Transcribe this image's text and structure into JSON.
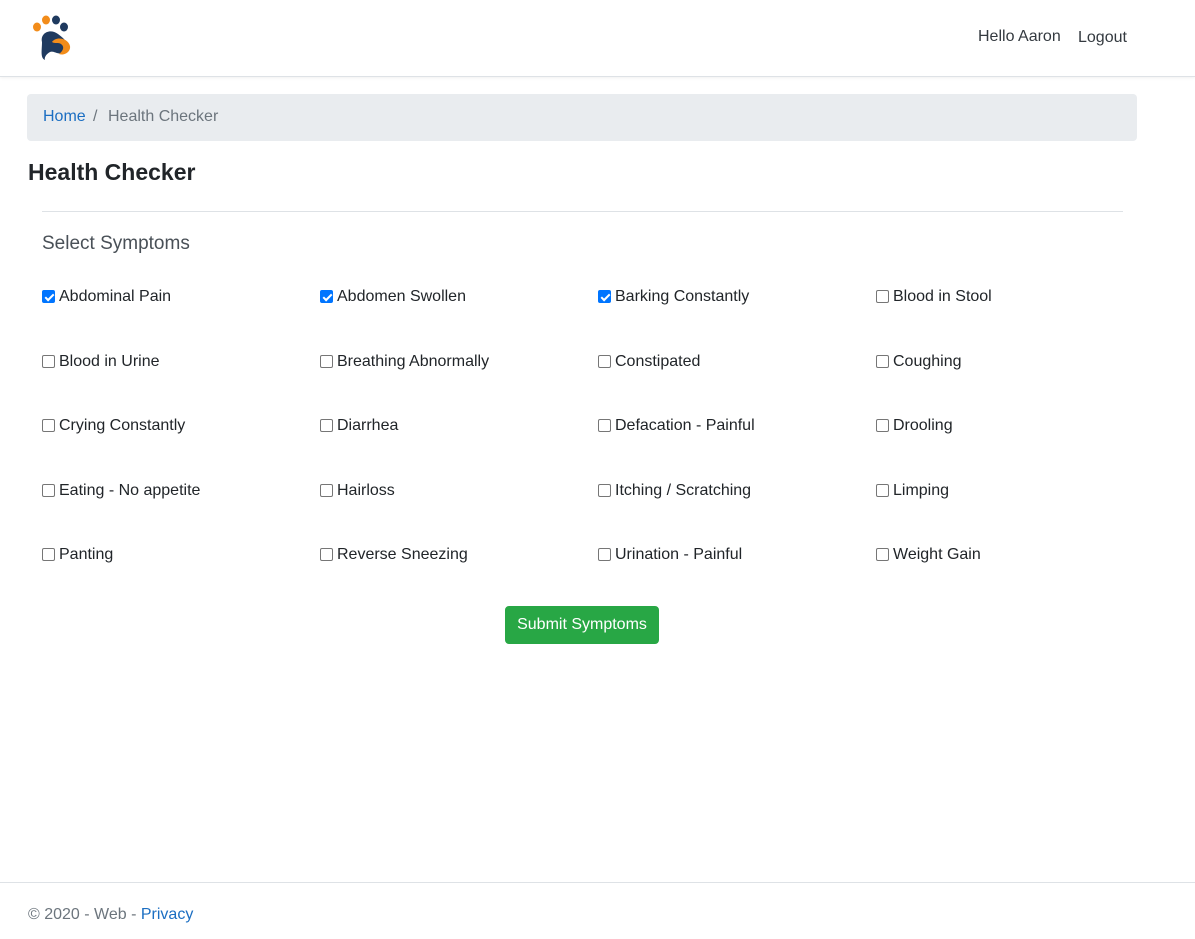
{
  "navbar": {
    "greeting": "Hello Aaron",
    "logout_label": "Logout",
    "logo_icon": "paw-logo-icon",
    "logo_colors": [
      "#1f3a5f",
      "#f28c1a"
    ]
  },
  "breadcrumb": {
    "home": "Home",
    "separator": "/",
    "current": "Health Checker"
  },
  "page": {
    "title": "Health Checker",
    "section_title": "Select Symptoms",
    "submit_label": "Submit Symptoms"
  },
  "symptoms": [
    {
      "label": "Abdominal Pain",
      "checked": true
    },
    {
      "label": "Abdomen Swollen",
      "checked": true
    },
    {
      "label": "Barking Constantly",
      "checked": true
    },
    {
      "label": "Blood in Stool",
      "checked": false
    },
    {
      "label": "Blood in Urine",
      "checked": false
    },
    {
      "label": "Breathing Abnormally",
      "checked": false
    },
    {
      "label": "Constipated",
      "checked": false
    },
    {
      "label": "Coughing",
      "checked": false
    },
    {
      "label": "Crying Constantly",
      "checked": false
    },
    {
      "label": "Diarrhea",
      "checked": false
    },
    {
      "label": "Defacation - Painful",
      "checked": false
    },
    {
      "label": "Drooling",
      "checked": false
    },
    {
      "label": "Eating - No appetite",
      "checked": false
    },
    {
      "label": "Hairloss",
      "checked": false
    },
    {
      "label": "Itching / Scratching",
      "checked": false
    },
    {
      "label": "Limping",
      "checked": false
    },
    {
      "label": "Panting",
      "checked": false
    },
    {
      "label": "Reverse Sneezing",
      "checked": false
    },
    {
      "label": "Urination - Painful",
      "checked": false
    },
    {
      "label": "Weight Gain",
      "checked": false
    }
  ],
  "footer": {
    "text": "© 2020 - Web - ",
    "privacy_label": "Privacy"
  },
  "colors": {
    "link": "#1b6ec2",
    "submit": "#28a745",
    "checkbox_checked": "#0075ff",
    "breadcrumb_bg": "#e9ecef"
  }
}
